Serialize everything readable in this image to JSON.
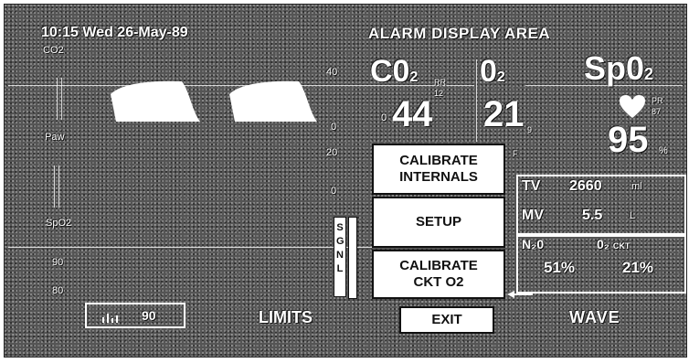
{
  "header": {
    "datetime": "10:15 Wed 26-May-89",
    "alarm_area": "ALARM DISPLAY AREA"
  },
  "left_labels": {
    "co2": "CO2",
    "paw": "Paw",
    "spo2": "SpO2",
    "scale_90": "90",
    "scale_80": "80"
  },
  "scale": {
    "top": "40",
    "mid": "0",
    "paw_top": "20",
    "paw_bottom": "0"
  },
  "vitals": {
    "co2_label": "C0",
    "co2_sub": "2",
    "co2_rr_label": "RR",
    "co2_rr_value": "12",
    "co2_value": "44",
    "co2_small": "0",
    "o2_label": "0",
    "o2_sub": "2",
    "o2_value": "21",
    "o2_small_top": "9",
    "o2_small_bottom": "F",
    "spo2_label": "Sp0",
    "spo2_sub": "2",
    "spo2_pr_label": "PR",
    "spo2_pr_value": "87",
    "spo2_value": "95",
    "pct": "%"
  },
  "volumes": {
    "tv_label": "TV",
    "tv_value": "2660",
    "tv_unit": "ml",
    "mv_label": "MV",
    "mv_value": "5.5",
    "mv_unit": "L",
    "n2o_label": "N₂0",
    "n2o_value": "51%",
    "o2_ckt_label": "0₂",
    "o2_ckt_suffix": "CKT",
    "o2_ckt_value": "21%"
  },
  "signal_label": "SGNL",
  "menu": {
    "calibrate_internals": "CALIBRATE\nINTERNALS",
    "setup": "SETUP",
    "calibrate_ckt": "CALIBRATE\nCKT O2",
    "exit": "EXIT"
  },
  "bottom": {
    "spo2_box_value": "90",
    "limits": "LIMITS",
    "wave": "WAVE"
  },
  "icons": {
    "heart": "heart-icon"
  }
}
